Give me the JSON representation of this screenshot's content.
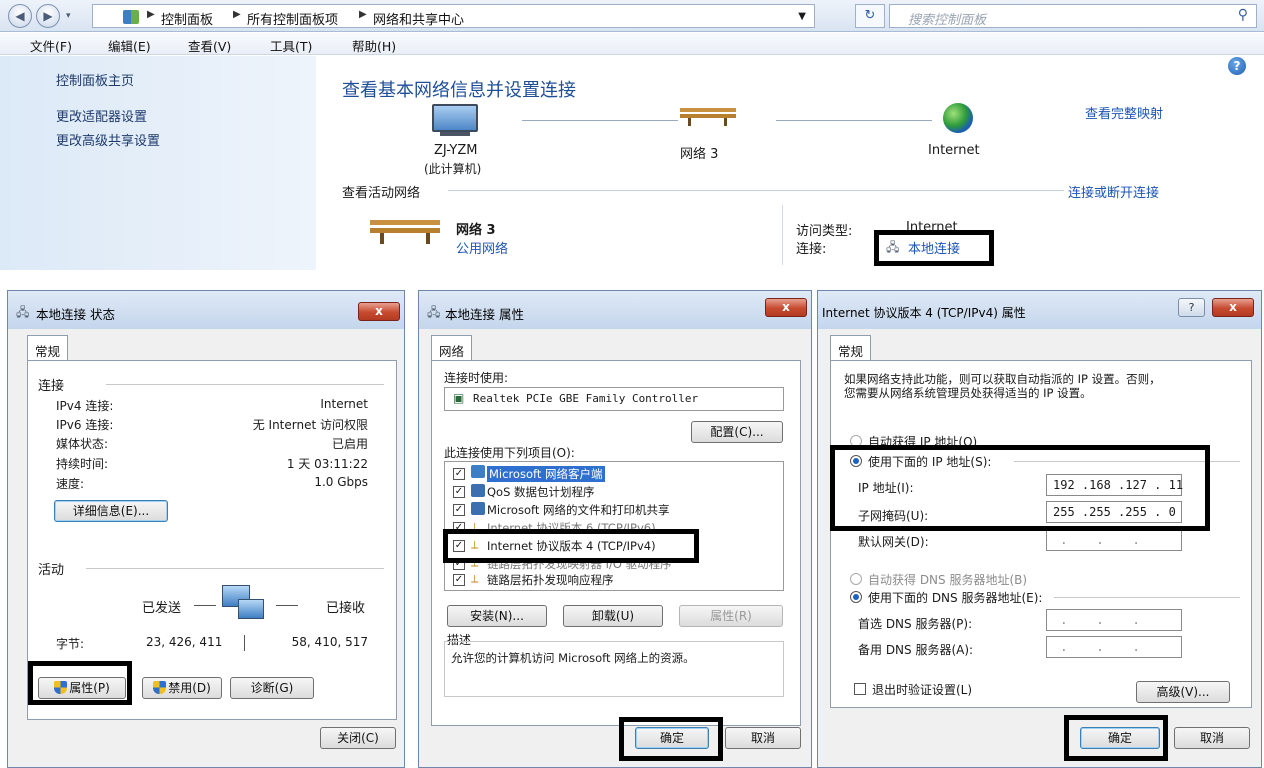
{
  "explorer": {
    "breadcrumbs": [
      "控制面板",
      "所有控制面板项",
      "网络和共享中心"
    ],
    "search_placeholder": "搜索控制面板",
    "menu": [
      "文件(F)",
      "编辑(E)",
      "查看(V)",
      "工具(T)",
      "帮助(H)"
    ],
    "left_links": [
      "控制面板主页",
      "更改适配器设置",
      "更改高级共享设置"
    ],
    "heading": "查看基本网络信息并设置连接",
    "view_full_map": "查看完整映射",
    "map": {
      "computer": "ZJ-YZM",
      "computer_sub": "(此计算机)",
      "network": "网络 3",
      "internet": "Internet"
    },
    "active_networks_label": "查看活动网络",
    "connect_disconnect": "连接或断开连接",
    "active": {
      "name": "网络 3",
      "type": "公用网络",
      "access_type_label": "访问类型:",
      "access_type_value": "Internet",
      "connection_label": "连接:",
      "connection_value": "本地连接"
    }
  },
  "status_dialog": {
    "title": "本地连接 状态",
    "close_x": "x",
    "tab": "常规",
    "connection_section": "连接",
    "rows": [
      {
        "label": "IPv4 连接:",
        "value": "Internet"
      },
      {
        "label": "IPv6 连接:",
        "value": "无 Internet 访问权限"
      },
      {
        "label": "媒体状态:",
        "value": "已启用"
      },
      {
        "label": "持续时间:",
        "value": "1 天 03:11:22"
      },
      {
        "label": "速度:",
        "value": "1.0 Gbps"
      }
    ],
    "details_button": "详细信息(E)...",
    "activity_section": "活动",
    "sent_label": "已发送",
    "received_label": "已接收",
    "bytes_label": "字节:",
    "bytes_sent": "23, 426, 411",
    "bytes_received": "58, 410, 517",
    "properties_button": "属性(P)",
    "disable_button": "禁用(D)",
    "diagnose_button": "诊断(G)",
    "close_button": "关闭(C)"
  },
  "props_dialog": {
    "title": "本地连接 属性",
    "close_x": "x",
    "tab": "网络",
    "connect_using_label": "连接时使用:",
    "adapter": "Realtek PCIe GBE Family Controller",
    "configure_button": "配置(C)...",
    "items_label": "此连接使用下列项目(O):",
    "items": [
      "Microsoft 网络客户端",
      "QoS 数据包计划程序",
      "Microsoft 网络的文件和打印机共享",
      "Internet 协议版本 6 (TCP/IPv6)",
      "Internet 协议版本 4 (TCP/IPv4)",
      "链路层拓扑发现映射器 I/O 驱动程序",
      "链路层拓扑发现响应程序"
    ],
    "install_button": "安装(N)...",
    "uninstall_button": "卸载(U)",
    "properties_button": "属性(R)",
    "description_label": "描述",
    "description": "允许您的计算机访问 Microsoft 网络上的资源。",
    "ok_button": "确定",
    "cancel_button": "取消"
  },
  "ipv4_dialog": {
    "title": "Internet 协议版本 4 (TCP/IPv4) 属性",
    "help_button": "?",
    "close_x": "x",
    "tab": "常规",
    "intro_line1": "如果网络支持此功能，则可以获取自动指派的 IP 设置。否则，",
    "intro_line2": "您需要从网络系统管理员处获得适当的 IP 设置。",
    "auto_ip": "自动获得 IP 地址(O)",
    "manual_ip": "使用下面的 IP 地址(S):",
    "ip_label": "IP 地址(I):",
    "ip_value": "192 .168 .127 . 11",
    "mask_label": "子网掩码(U):",
    "mask_value": "255 .255 .255 . 0",
    "gateway_label": "默认网关(D):",
    "empty_ip": " .    .    .",
    "auto_dns": "自动获得 DNS 服务器地址(B)",
    "manual_dns": "使用下面的 DNS 服务器地址(E):",
    "preferred_dns_label": "首选 DNS 服务器(P):",
    "alternate_dns_label": "备用 DNS 服务器(A):",
    "validate_label": "退出时验证设置(L)",
    "advanced_button": "高级(V)...",
    "ok_button": "确定",
    "cancel_button": "取消"
  }
}
